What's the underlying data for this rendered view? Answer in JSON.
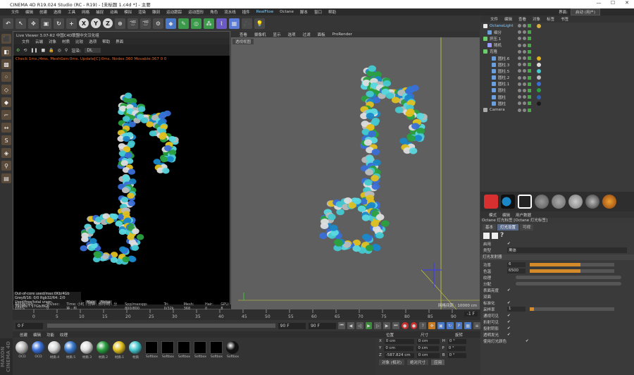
{
  "window": {
    "title": "CINEMA 4D R19.024 Studio (RC - R19) - [未标题 1.c4d *] - 主要",
    "controls": [
      "—",
      "☐",
      "✕"
    ]
  },
  "menubar": [
    "文件",
    "编辑",
    "创建",
    "选择",
    "工具",
    "网格",
    "捕捉",
    "动画",
    "模拟",
    "渲染",
    "雕刻",
    "运动跟踪",
    "运动图形",
    "角色",
    "流水线",
    "插件",
    "RealFlow",
    "Octane",
    "脚本",
    "窗口",
    "帮助"
  ],
  "layout": {
    "label": "界面:",
    "value": "启动 (用户)"
  },
  "toolbar": {
    "axes": [
      "X",
      "Y",
      "Z"
    ]
  },
  "live_viewer": {
    "title": "Live Viewer 3.07-R2 中国C4D联盟中文汉化组",
    "menu": [
      "文件",
      "云端",
      "对象",
      "材质",
      "比较",
      "选项",
      "帮助",
      "界面"
    ],
    "render_label": "渲染:",
    "render_value": "DL",
    "status": "Check:1ms./4ms. MeshGen:0ms. Update[C]:0ms. Nodes:360 Movable:367  0 0",
    "stats": [
      "Out-of-core used/max:0Kb/4Gb",
      "Grey8/16: 0/0        Rgb32/64: 2/0",
      "Used/free/total vram: 390Mb/7.17Gb/8Gb"
    ],
    "main_tag": "Main",
    "noise_tag": "Noise",
    "render_bar": [
      "Rendering: 100%",
      "Ms/sec: 0",
      "Time: 小时 : 分钟 : 秒/小时 : 分钟 : 秒",
      "Spp/maxspp: 800/800",
      "Tri: 0/32k",
      "Mesh: 368",
      "Hair: 0",
      "GPU: 8"
    ]
  },
  "viewport": {
    "menu": [
      "查看",
      "摄像机",
      "显示",
      "选项",
      "过滤",
      "面板",
      "ProRender"
    ],
    "camera": "透视视图",
    "grid": "网格间距 : 10000 cm"
  },
  "object_manager": {
    "menu": [
      "文件",
      "编辑",
      "查看",
      "对象",
      "标签",
      "书签"
    ],
    "objects": [
      {
        "name": "OctaneLight",
        "color": "#e8e8e8",
        "tag": "#d8b040"
      },
      {
        "name": "细分",
        "color": "#6aa0e0",
        "tag": ""
      },
      {
        "name": "挤压.1",
        "color": "#6acf6a",
        "tag": ""
      },
      {
        "name": "随机",
        "color": "#9a9aff",
        "tag": ""
      },
      {
        "name": "克隆",
        "color": "#6acf6a",
        "tag": ""
      },
      {
        "name": "圆柱.6",
        "color": "#6aa0e0",
        "tag": "#e0b020"
      },
      {
        "name": "圆柱.3",
        "color": "#6aa0e0",
        "tag": "#ddd"
      },
      {
        "name": "圆柱.5",
        "color": "#6aa0e0",
        "tag": "#46c8d0"
      },
      {
        "name": "圆柱.2",
        "color": "#6aa0e0",
        "tag": "#bbb"
      },
      {
        "name": "圆柱.1",
        "color": "#6aa0e0",
        "tag": "#3a6fd8"
      },
      {
        "name": "圆柱",
        "color": "#6aa0e0",
        "tag": "#2aa040"
      },
      {
        "name": "圆柱",
        "color": "#6aa0e0",
        "tag": "#3060b0"
      },
      {
        "name": "圆柱",
        "color": "#6aa0e0",
        "tag": "#1a1a1a"
      },
      {
        "name": "Camera",
        "color": "#aaa",
        "tag": ""
      }
    ]
  },
  "attr_manager": {
    "menu": [
      "模式",
      "编辑",
      "用户数据"
    ],
    "title": "Octane 灯光标签 [Octane 灯光标签]",
    "tabs": [
      "基本",
      "灯光设置",
      "可视"
    ],
    "enabled_label": "启用",
    "type_label": "类型",
    "type_value": "黑体",
    "section": "灯光发射器",
    "power_label": "功率",
    "power_value": "6",
    "temp_label": "色温",
    "temp_value": "6500",
    "texture_label": "纹理",
    "distribution_label": "分配",
    "surface_label": "表面亮度",
    "keep_label": "双面",
    "norm_label": "标准化",
    "sample_label": "采样率",
    "sample_value": "1",
    "checks": [
      "通视可见",
      "折射可见",
      "投射阴影",
      "透明发光"
    ],
    "last_label": "使用灯光颜色",
    "power_level": 0.6,
    "temp_level": 0.6,
    "sample_level": 0.05
  },
  "timeline": {
    "ticks": [
      "0",
      "5",
      "10",
      "15",
      "20",
      "25",
      "30",
      "35",
      "40",
      "45",
      "50",
      "55",
      "60",
      "65",
      "70",
      "75",
      "80",
      "85",
      "90"
    ],
    "end_field": "-1 F"
  },
  "transport": {
    "start": "0 F",
    "end": "90 F",
    "current": "90 F"
  },
  "materials": {
    "menu": [
      "创建",
      "编辑",
      "功能",
      "纹理"
    ],
    "items": [
      {
        "label": "OCD",
        "kind": "ball",
        "color": "#bbb"
      },
      {
        "label": "OCD",
        "kind": "ball",
        "color": "#3a6fd8"
      },
      {
        "label": "材质.4",
        "kind": "ball",
        "color": "#d8d8d8"
      },
      {
        "label": "材质.5",
        "kind": "ball",
        "color": "#3a7ad0"
      },
      {
        "label": "材质.3",
        "kind": "ball",
        "color": "#ddd"
      },
      {
        "label": "材质.2",
        "kind": "ball",
        "color": "#2aa040"
      },
      {
        "label": "材质.1",
        "kind": "ball",
        "color": "#e0c020"
      },
      {
        "label": "材质",
        "kind": "ball",
        "color": "#46c8d0"
      },
      {
        "label": "Softbox",
        "kind": "sq",
        "color": "#000"
      },
      {
        "label": "Softbox",
        "kind": "sq",
        "color": "#000"
      },
      {
        "label": "Softbox",
        "kind": "sq",
        "color": "#000"
      },
      {
        "label": "Softbox",
        "kind": "sq",
        "color": "#000"
      },
      {
        "label": "Softbox",
        "kind": "sq",
        "color": "#000"
      },
      {
        "label": "Softbox",
        "kind": "ball",
        "color": "#111"
      }
    ]
  },
  "coords": {
    "headers": [
      "位置",
      "尺寸",
      "旋转"
    ],
    "rows": [
      [
        "X",
        "0 cm",
        "0 cm",
        "H",
        "0 °"
      ],
      [
        "Y",
        "0 cm",
        "0 cm",
        "P",
        "0 °"
      ],
      [
        "Z",
        "-587.824 cm",
        "0 cm",
        "B",
        "0 °"
      ]
    ],
    "mode": "对象 (相对)",
    "size_mode": "绝对尺寸",
    "apply": "应用"
  },
  "brand": "MAXON CINEMA 4D"
}
